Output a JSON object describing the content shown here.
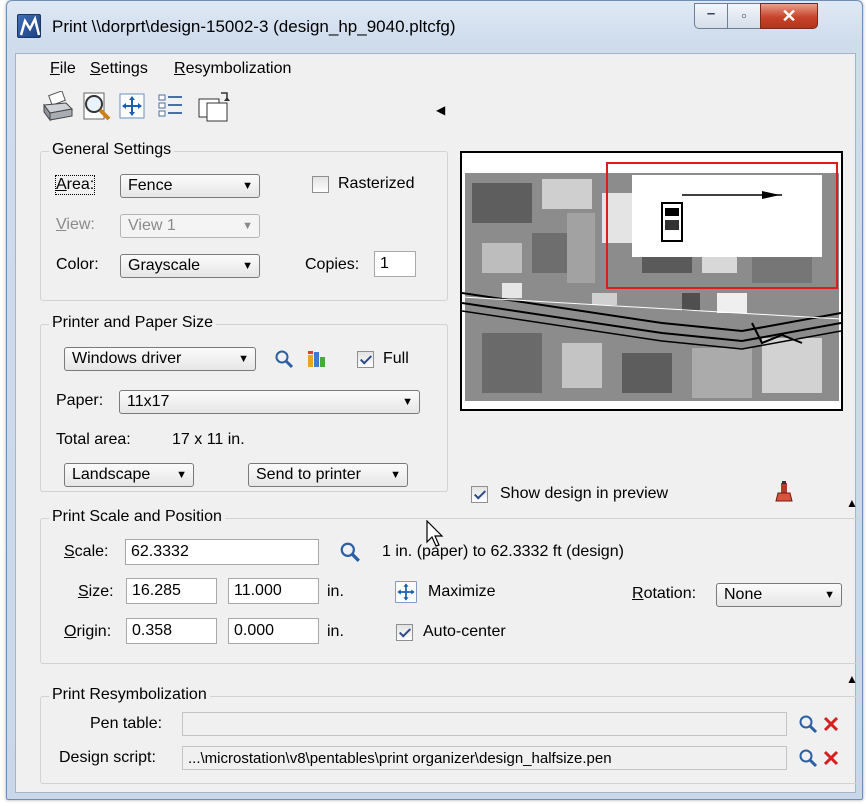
{
  "window": {
    "title": "Print  \\\\dorprt\\design-15002-3  (design_hp_9040.pltcfg)",
    "controls": {
      "minimize": "–",
      "maximize": "▫",
      "close": "✕"
    }
  },
  "menu": [
    "File",
    "Settings",
    "Resymbolization"
  ],
  "toolbar": {
    "icons": [
      "printer-icon",
      "preview-magnifier-icon",
      "fit-icon",
      "list-icon",
      "copy-icon"
    ],
    "collapse_arrow": "◀"
  },
  "general": {
    "title": "General Settings",
    "area_label": "Area:",
    "area_value": "Fence",
    "rasterized_label": "Rasterized",
    "rasterized_checked": false,
    "view_label": "View:",
    "view_value": "View 1",
    "color_label": "Color:",
    "color_value": "Grayscale",
    "copies_label": "Copies:",
    "copies_value": "1"
  },
  "printer": {
    "title": "Printer and Paper Size",
    "driver_value": "Windows driver",
    "full_label": "Full",
    "full_checked": true,
    "paper_label": "Paper:",
    "paper_value": "11x17",
    "total_area_label": "Total area:",
    "total_area_value": "17 x 11 in.",
    "orientation_value": "Landscape",
    "destination_value": "Send to printer"
  },
  "preview": {
    "show_design_label": "Show design in preview",
    "show_design_checked": true,
    "expand_arrow": "▲"
  },
  "scale": {
    "title": "Print Scale and Position",
    "scale_label": "Scale:",
    "scale_value": "62.3332",
    "scale_desc": "1 in. (paper) to 62.3332 ft (design)",
    "size_label": "Size:",
    "size_w": "16.285",
    "size_h": "11.000",
    "size_unit": "in.",
    "maximize_label": "Maximize",
    "rotation_label": "Rotation:",
    "rotation_value": "None",
    "origin_label": "Origin:",
    "origin_x": "0.358",
    "origin_y": "0.000",
    "origin_unit": "in.",
    "autocenter_label": "Auto-center",
    "autocenter_checked": true
  },
  "resymbolization": {
    "title": "Print Resymbolization",
    "pen_table_label": "Pen table:",
    "pen_table_value": "",
    "design_script_label": "Design script:",
    "design_script_value": "...\\microstation\\v8\\pentables\\print organizer\\design_halfsize.pen",
    "expand_arrow": "▲"
  },
  "colors": {
    "accent": "#3c7fb1",
    "fence_red": "#e01b1b",
    "delete_red": "#d42020",
    "checkmark": "#2b4a86"
  }
}
